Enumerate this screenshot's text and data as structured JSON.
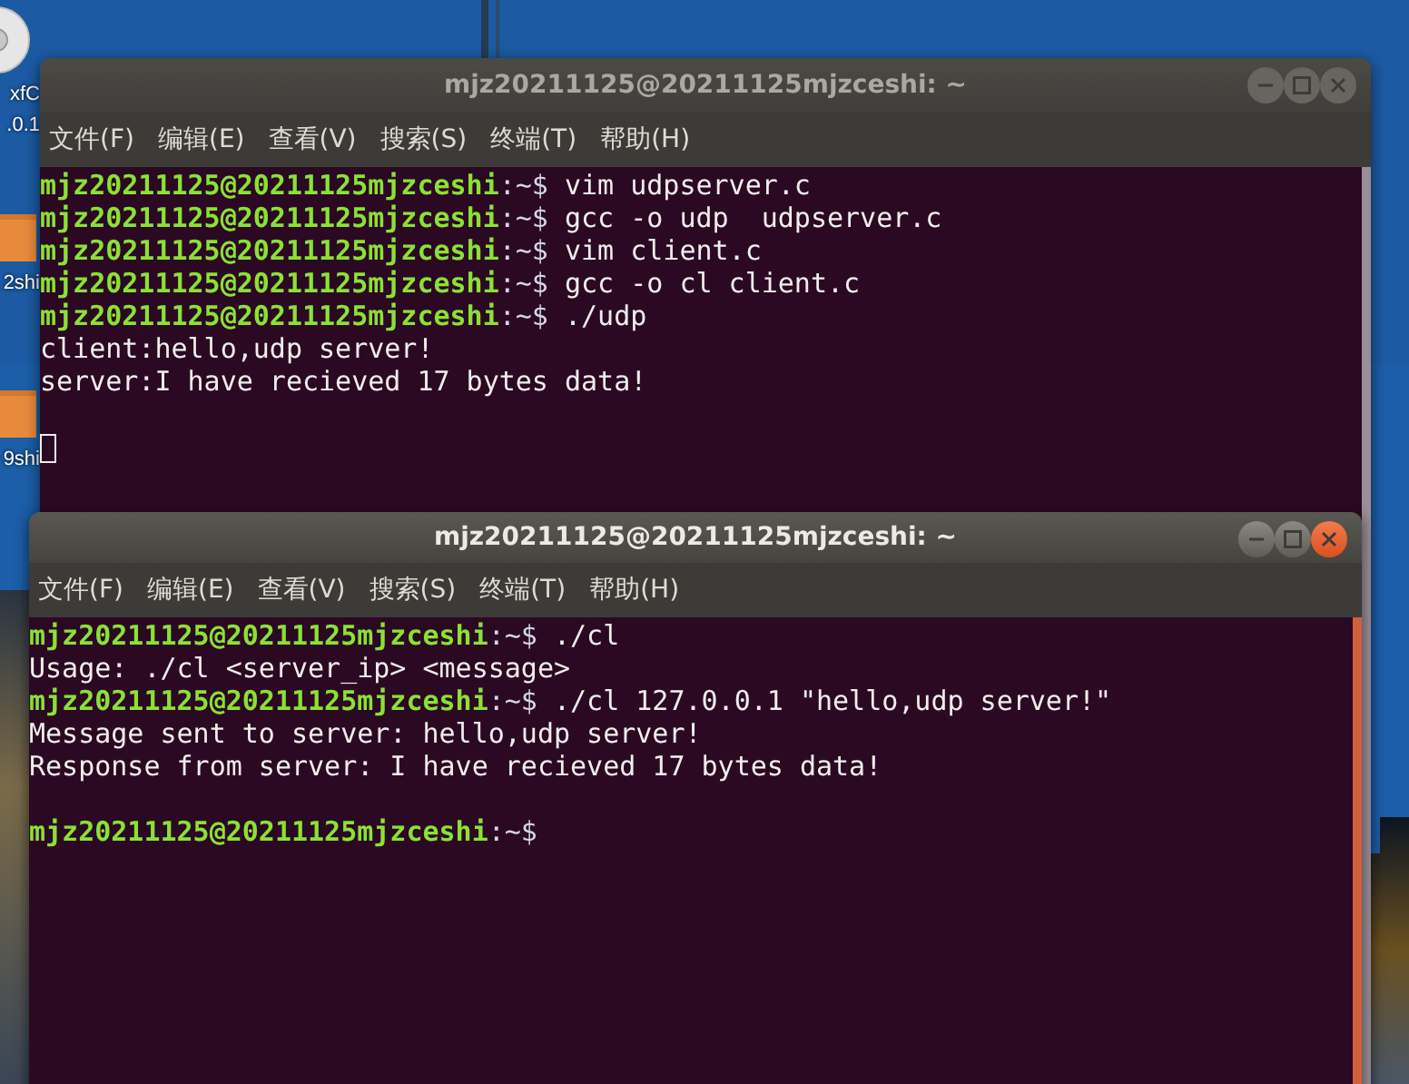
{
  "desktop": {
    "icons": [
      {
        "kind": "disc",
        "label_lines": [
          "xfC",
          ".0.1"
        ]
      },
      {
        "kind": "folder",
        "label_lines": [
          "2shi"
        ]
      },
      {
        "kind": "folder",
        "label_lines": [
          "9shi"
        ]
      }
    ]
  },
  "windows": [
    {
      "title": "mjz20211125@20211125mjzceshi: ~",
      "active": false,
      "menu": [
        "文件(F)",
        "编辑(E)",
        "查看(V)",
        "搜索(S)",
        "终端(T)",
        "帮助(H)"
      ],
      "lines": [
        {
          "kind": "prompt",
          "prompt": "mjz20211125@20211125mjzceshi",
          "path": ":~$",
          "command": "vim udpserver.c"
        },
        {
          "kind": "prompt",
          "prompt": "mjz20211125@20211125mjzceshi",
          "path": ":~$",
          "command": "gcc -o udp  udpserver.c"
        },
        {
          "kind": "prompt",
          "prompt": "mjz20211125@20211125mjzceshi",
          "path": ":~$",
          "command": "vim client.c"
        },
        {
          "kind": "prompt",
          "prompt": "mjz20211125@20211125mjzceshi",
          "path": ":~$",
          "command": "gcc -o cl client.c"
        },
        {
          "kind": "prompt",
          "prompt": "mjz20211125@20211125mjzceshi",
          "path": ":~$",
          "command": "./udp"
        },
        {
          "kind": "output",
          "text": "client:hello,udp server!"
        },
        {
          "kind": "output",
          "text": "server:I have recieved 17 bytes data!"
        },
        {
          "kind": "blank"
        },
        {
          "kind": "cursor"
        }
      ]
    },
    {
      "title": "mjz20211125@20211125mjzceshi: ~",
      "active": true,
      "menu": [
        "文件(F)",
        "编辑(E)",
        "查看(V)",
        "搜索(S)",
        "终端(T)",
        "帮助(H)"
      ],
      "lines": [
        {
          "kind": "prompt",
          "prompt": "mjz20211125@20211125mjzceshi",
          "path": ":~$",
          "command": "./cl"
        },
        {
          "kind": "output",
          "text": "Usage: ./cl <server_ip> <message>"
        },
        {
          "kind": "prompt",
          "prompt": "mjz20211125@20211125mjzceshi",
          "path": ":~$",
          "command": "./cl 127.0.0.1 \"hello,udp server!\""
        },
        {
          "kind": "output",
          "text": "Message sent to server: hello,udp server!"
        },
        {
          "kind": "output",
          "text": "Response from server: I have recieved 17 bytes data!"
        },
        {
          "kind": "blank"
        },
        {
          "kind": "prompt",
          "prompt": "mjz20211125@20211125mjzceshi",
          "path": ":~$"
        }
      ]
    }
  ]
}
